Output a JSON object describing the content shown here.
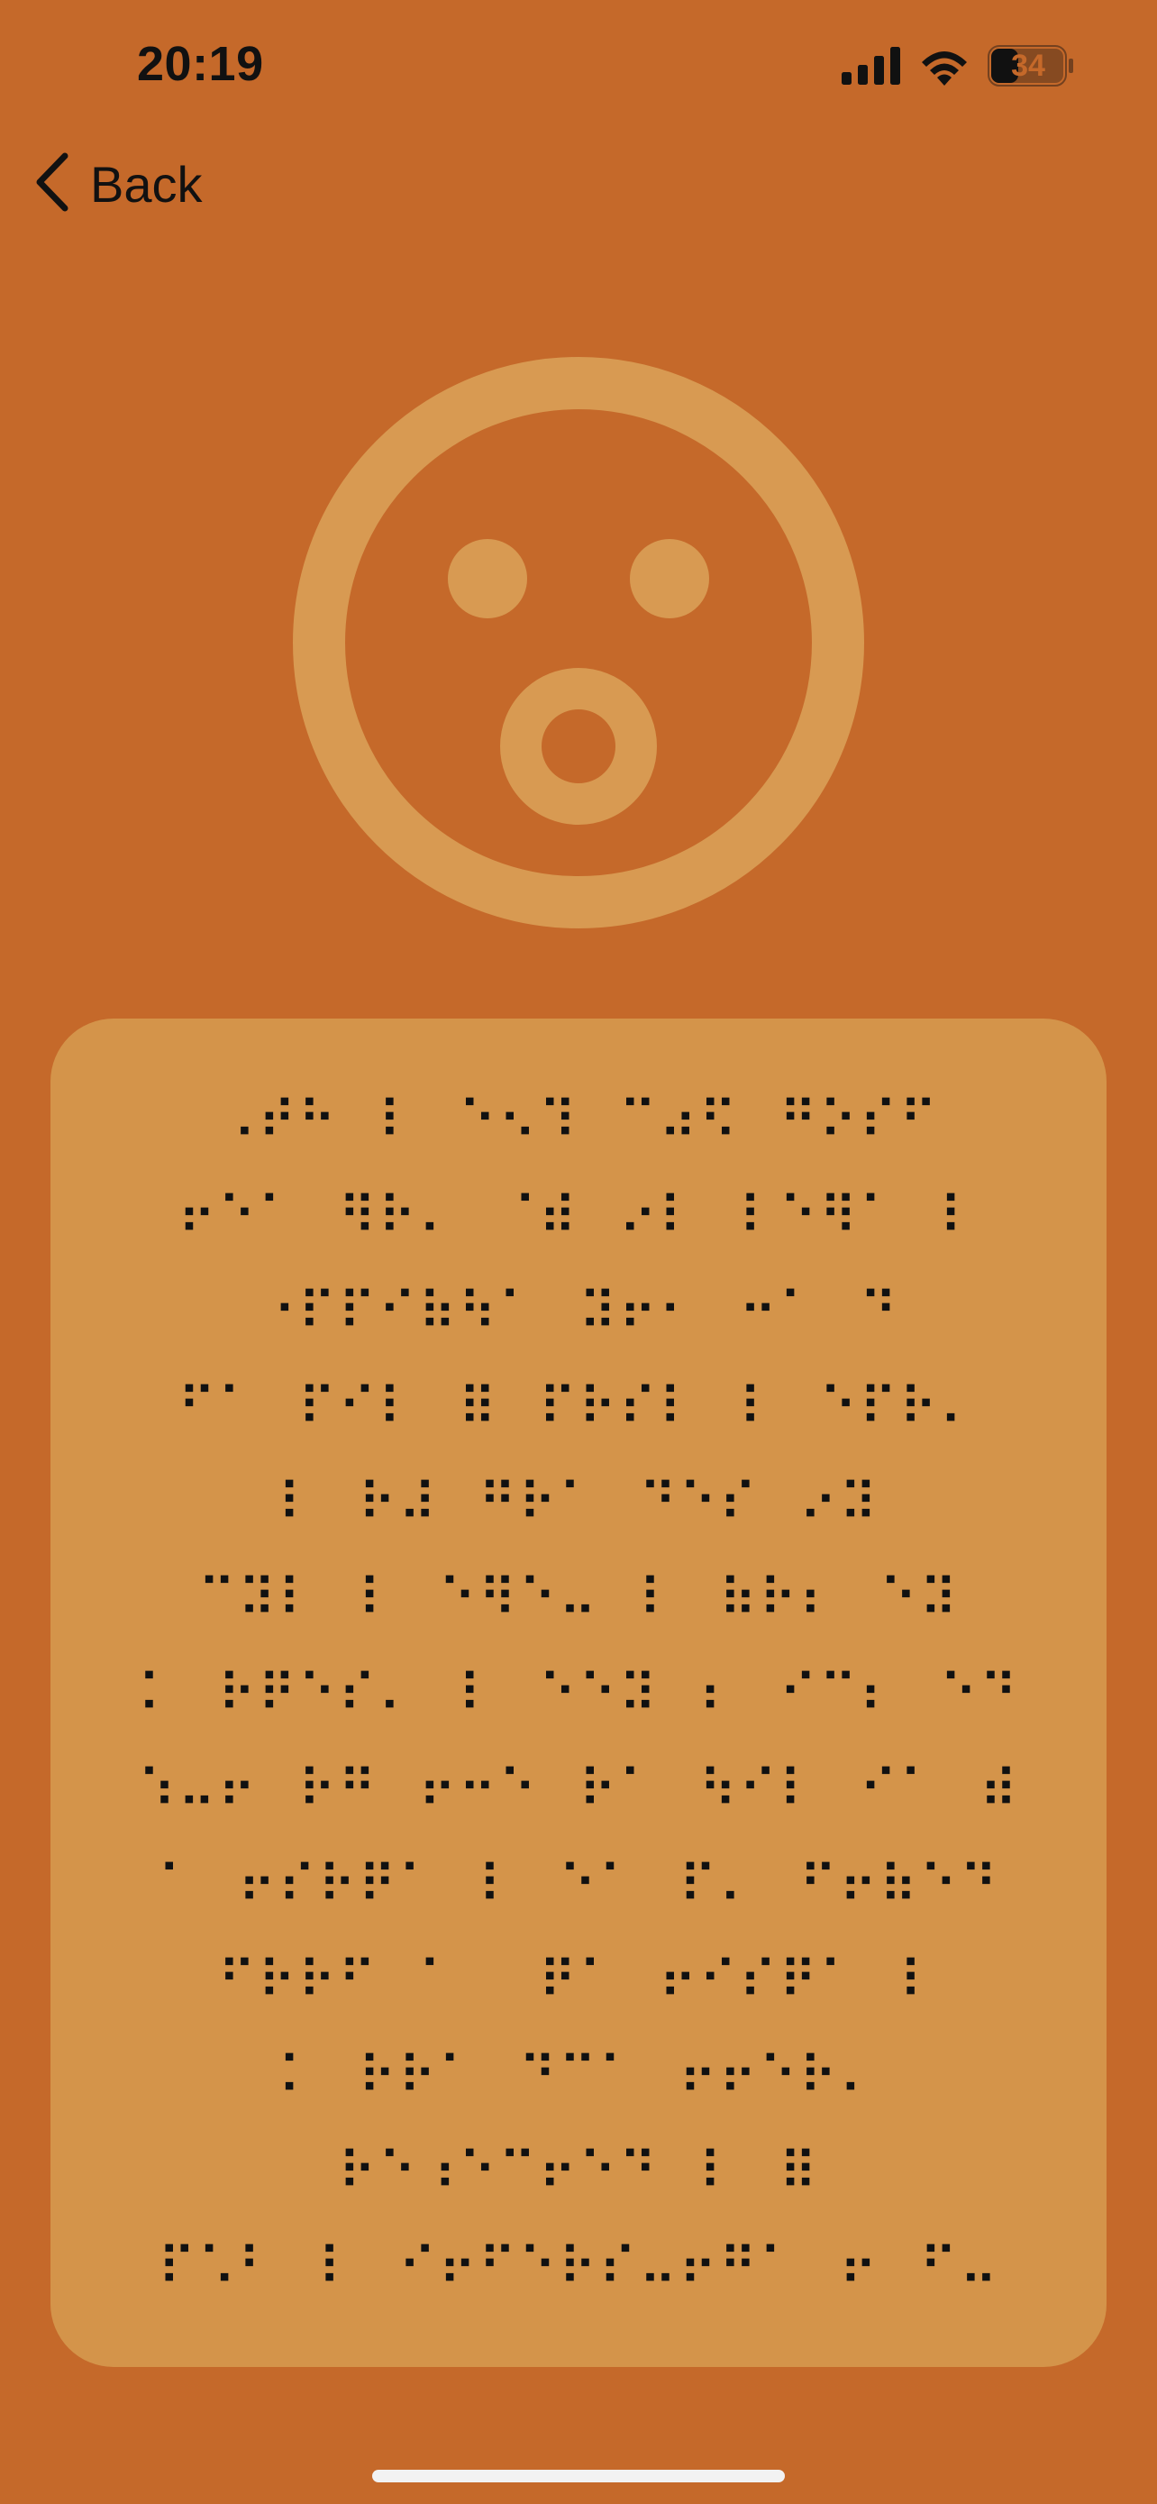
{
  "status_bar": {
    "time": "20:19",
    "battery": "34",
    "icons": [
      "signal-icon",
      "wifi-icon",
      "battery-icon"
    ]
  },
  "nav": {
    "back_label": "Back",
    "back_icon": "chevron-left-icon"
  },
  "hero": {
    "icon": "surprised-face-icon"
  },
  "braille": {
    "lines": [
      "⠠⠞⠓⠀⠇⠀⠑⠢⠹⠀⠉⠴⠫⠀⠛⠕⠎⠋",
      "⠖⠑⠁⠀⠻⠗⠄⠀⠈⠾⠀⠔⠇⠀⠇⠑⠻⠁⠀⠇",
      "⠐⠏⠏⠊⠷⠳⠁⠀⠽⠖⠂⠀⠒⠁⠀⠙",
      "⠋⠁⠀⠏⠊⠇⠀⠿⠀⠏⠗⠎⠇⠀⠇⠀⠑⠏⠗⠄",
      "⠇⠀⠗⠼⠀⠛⠗⠁⠀⠙⠑⠎⠀⠔⠽",
      "⠉⠽⠇⠀⠇⠀⠑⠻⠑⠤⠀⠇⠀⠷⠗⠆⠀⠑⠽",
      "⠅⠀⠗⠟⠑⠎⠄⠀⠇⠀⠑⠑⠽⠀⠆⠀⠊⠉⠆⠀⠑⠙",
      "⠱⠤⠖⠀⠗⠛⠀⠖⠒⠑⠀⠗⠁⠀⠳⠊⠇⠀⠊⠁⠀⠾",
      "⠁⠀⠖⠎⠗⠟⠁⠀⠇⠀⠑⠁⠀⠏⠄⠀⠋⠖⠷⠑⠙",
      "⠋⠗⠗⠋⠀⠁⠀⠀⠟⠁⠀⠖⠊⠎⠟⠁⠀⠇",
      "⠅⠀⠗⠗⠁⠀⠙⠉⠁⠀⠖⠖⠑⠗⠄",
      "⠗⠑⠰⠑⠉⠖⠑⠙⠀⠇⠀⠿",
      "⠏⠡⠃⠀⠇⠀⠊⠖⠋⠑⠗⠎⠤⠖⠛⠁⠀⠖⠀⠋⠤"
    ]
  },
  "colors": {
    "background": "#C5692A",
    "card": "#D4944A",
    "icon": "#D89A52",
    "text": "#111111",
    "home_indicator": "#F2F2F2"
  }
}
